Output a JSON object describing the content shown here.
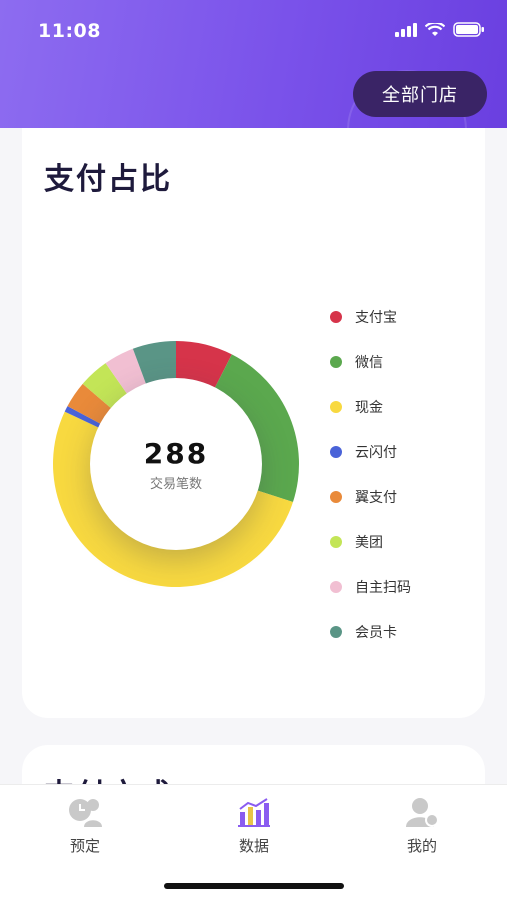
{
  "status_bar": {
    "time": "11:08"
  },
  "header": {
    "store_button": "全部门店"
  },
  "payment_ratio": {
    "title": "支付占比",
    "center_value": "288",
    "center_label": "交易笔数"
  },
  "payment_method": {
    "title": "支付方式"
  },
  "tabbar": {
    "items": [
      {
        "label": "预定"
      },
      {
        "label": "数据"
      },
      {
        "label": "我的"
      }
    ]
  },
  "chart_data": {
    "type": "pie",
    "donut": true,
    "categories": [
      "支付宝",
      "微信",
      "现金",
      "云闪付",
      "翼支付",
      "美团",
      "自主扫码",
      "会员卡"
    ],
    "values": [
      7.5,
      22.5,
      52,
      0.8,
      3.5,
      4,
      4,
      5.7
    ],
    "colors": [
      "#d6344a",
      "#5ba84e",
      "#f8d940",
      "#4a63d8",
      "#e98a3a",
      "#c3e557",
      "#f1bfd2",
      "#5a9586"
    ],
    "legend_position": "right"
  }
}
